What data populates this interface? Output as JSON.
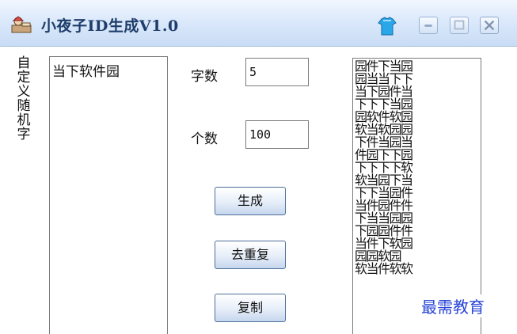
{
  "window": {
    "title": "小夜子ID生成V1.0"
  },
  "sidebar_label": [
    "自",
    "定",
    "义",
    "随",
    "机",
    "字"
  ],
  "word_list": {
    "items": [
      "当下软件园"
    ]
  },
  "fields": {
    "char_count_label": "字数",
    "char_count_value": "5",
    "count_label": "个数",
    "count_value": "100"
  },
  "buttons": {
    "generate": "生成",
    "dedupe": "去重复",
    "copy": "复制"
  },
  "output_lines": [
    "园件下当园",
    "园当当下下",
    "当下园件当",
    "下下下当园",
    "园软件软园",
    "软当软园园",
    "下件当园当",
    "件园下下园",
    "下下下下软",
    "软当园下当",
    "下下当园件",
    "当件园件件",
    "下当当园园",
    "下园园件件",
    "当件下软园",
    "园园软园",
    "软当件软软"
  ],
  "watermark": "最需教育",
  "icons": {
    "app": "app-icon",
    "skin": "skin-icon",
    "minimize": "minimize-icon",
    "maximize": "maximize-icon",
    "close": "close-icon"
  }
}
